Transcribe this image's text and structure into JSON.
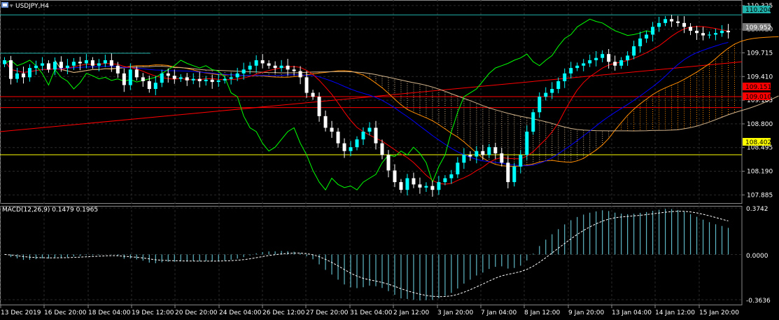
{
  "header": {
    "symbol_label": "USDJPY,H4"
  },
  "macd": {
    "label": "MACD(12,26,9) 0.1479 0.1965",
    "axis_top": "0.3742",
    "axis_zero": "0.0000",
    "axis_bottom": "-0.3636"
  },
  "colors": {
    "background": "#000000",
    "grid": "#2a2a2a",
    "bull_candle": "#00ffff",
    "bear_candle": "#ffffff",
    "kijun": "#0000ff",
    "tenkan": "#ff0000",
    "chikou": "#00ff00",
    "kumo_a": "#ff8c00",
    "kumo_b": "#d2b48c",
    "hline_top": "#20b2aa",
    "hline_red": "#ff0000",
    "hline_yellow": "#ffff00",
    "macd_hist": "#5fb8c6",
    "macd_signal": "#ffffff"
  },
  "price_levels": {
    "current": "109.952",
    "hline_top": "110.204",
    "hline_red_1": "109.151",
    "hline_red_2": "109.010",
    "hline_yellow": "108.402"
  },
  "chart_data": [
    {
      "type": "candlestick",
      "title": "USDJPY,H4",
      "x_labels": [
        "13 Dec 2019",
        "16 Dec 20:00",
        "18 Dec 04:00",
        "19 Dec 12:00",
        "20 Dec 20:00",
        "24 Dec 04:00",
        "26 Dec 12:00",
        "27 Dec 20:00",
        "31 Dec 04:00",
        "2 Jan 12:00",
        "3 Jan 20:00",
        "7 Jan 04:00",
        "8 Jan 12:00",
        "9 Jan 20:00",
        "13 Jan 04:00",
        "14 Jan 12:00",
        "15 Jan 20:00"
      ],
      "y_ticks": [
        "110.325",
        "110.020",
        "109.715",
        "109.410",
        "109.105",
        "108.800",
        "108.495",
        "108.190",
        "107.885"
      ],
      "ylim": [
        107.78,
        110.36
      ],
      "close_series": [
        109.62,
        109.38,
        109.45,
        109.4,
        109.52,
        109.55,
        109.58,
        109.5,
        109.6,
        109.52,
        109.55,
        109.6,
        109.58,
        109.62,
        109.55,
        109.58,
        109.62,
        109.55,
        109.45,
        109.3,
        109.5,
        109.4,
        109.35,
        109.25,
        109.33,
        109.45,
        109.42,
        109.38,
        109.4,
        109.36,
        109.38,
        109.35,
        109.37,
        109.34,
        109.36,
        109.38,
        109.4,
        109.45,
        109.5,
        109.55,
        109.62,
        109.58,
        109.55,
        109.52,
        109.55,
        109.5,
        109.48,
        109.4,
        109.2,
        109.15,
        108.9,
        108.75,
        108.7,
        108.55,
        108.45,
        108.5,
        108.6,
        108.7,
        108.75,
        108.55,
        108.4,
        108.2,
        108.05,
        107.95,
        108.1,
        108.02,
        107.98,
        108.0,
        107.95,
        108.05,
        108.1,
        108.15,
        108.3,
        108.4,
        108.38,
        108.45,
        108.4,
        108.5,
        108.42,
        108.3,
        108.05,
        108.25,
        108.4,
        108.7,
        108.95,
        109.15,
        109.2,
        109.25,
        109.35,
        109.45,
        109.52,
        109.55,
        109.58,
        109.62,
        109.65,
        109.7,
        109.6,
        109.55,
        109.62,
        109.68,
        109.8,
        109.9,
        109.95,
        110.05,
        110.1,
        110.15,
        110.12,
        110.1,
        110.05,
        110.0,
        109.97,
        109.94,
        109.95,
        109.97,
        110.0,
        109.98
      ]
    },
    {
      "type": "bar",
      "title": "MACD(12,26,9) 0.1479 0.1965",
      "main_value": 0.1479,
      "signal_value": 0.1965,
      "y_ticks": [
        "0.3742",
        "0.0000",
        "-0.3636"
      ],
      "ylim": [
        -0.3636,
        0.3742
      ]
    }
  ]
}
